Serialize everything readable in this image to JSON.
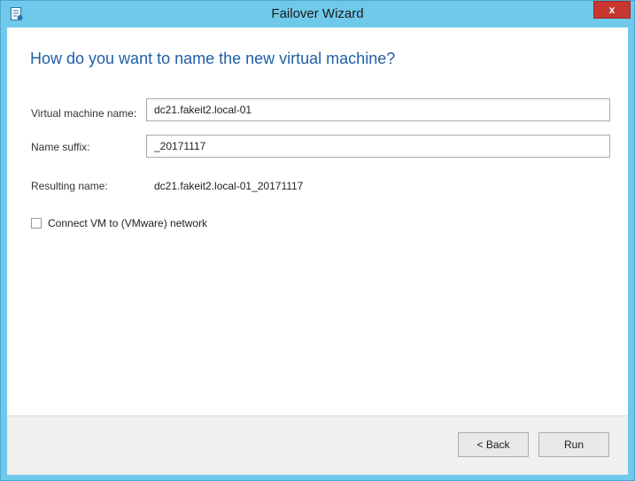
{
  "window": {
    "title": "Failover Wizard",
    "close_label": "x"
  },
  "page": {
    "heading": "How do you want to name the new virtual machine?"
  },
  "form": {
    "vm_name_label": "Virtual machine name:",
    "vm_name_value": "dc21.fakeit2.local-01",
    "suffix_label": "Name suffix:",
    "suffix_value": "_20171117",
    "resulting_label": "Resulting name:",
    "resulting_value": "dc21.fakeit2.local-01_20171117",
    "connect_label": "Connect VM to (VMware) network",
    "connect_checked": false
  },
  "footer": {
    "back_label": "< Back",
    "run_label": "Run"
  },
  "colors": {
    "title_bar": "#6fc9ea",
    "heading": "#1f5fa8",
    "close_button": "#c7372f"
  }
}
